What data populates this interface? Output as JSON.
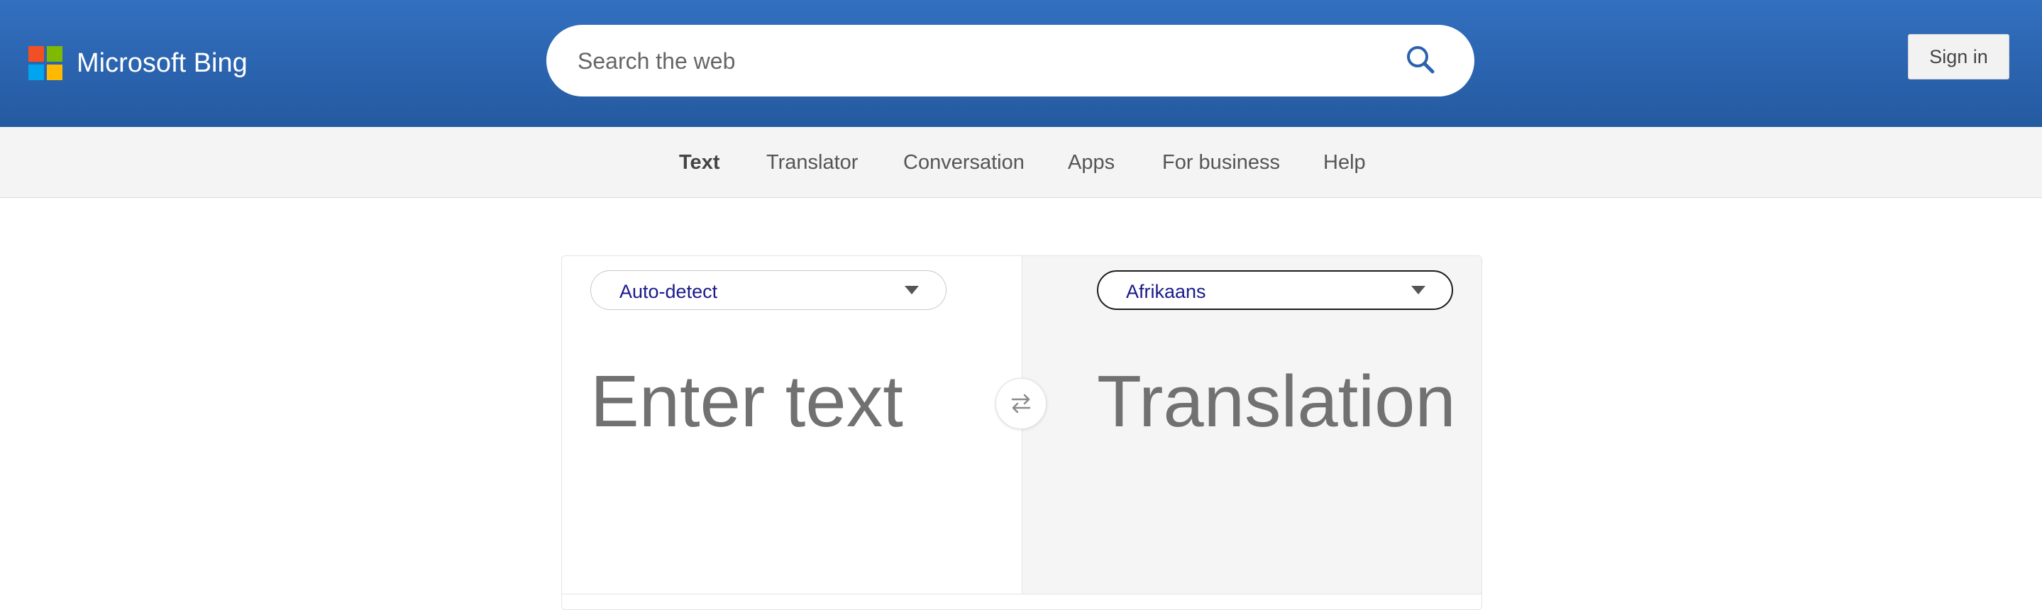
{
  "header": {
    "brand_name": "Microsoft Bing",
    "logo_colors": [
      "#f25022",
      "#7fba00",
      "#00a4ef",
      "#ffb900"
    ],
    "search": {
      "placeholder": "Search the web",
      "value": "",
      "icon": "search-icon"
    },
    "sign_in_label": "Sign in"
  },
  "nav": {
    "items": [
      {
        "label": "Text",
        "active": true
      },
      {
        "label": "Translator",
        "active": false
      },
      {
        "label": "Conversation",
        "active": false
      },
      {
        "label": "Apps",
        "active": false
      },
      {
        "label": "For business",
        "active": false
      },
      {
        "label": "Help",
        "active": false
      }
    ]
  },
  "translator": {
    "source_language": "Auto-detect",
    "target_language": "Afrikaans",
    "source_placeholder": "Enter text",
    "translation_placeholder": "Translation",
    "swap_icon": "swap-arrows-icon"
  },
  "colors": {
    "header_blue": "#2a62ad",
    "nav_background": "#f4f4f4",
    "language_text": "#1a1a8c",
    "placeholder_text": "#717171"
  }
}
